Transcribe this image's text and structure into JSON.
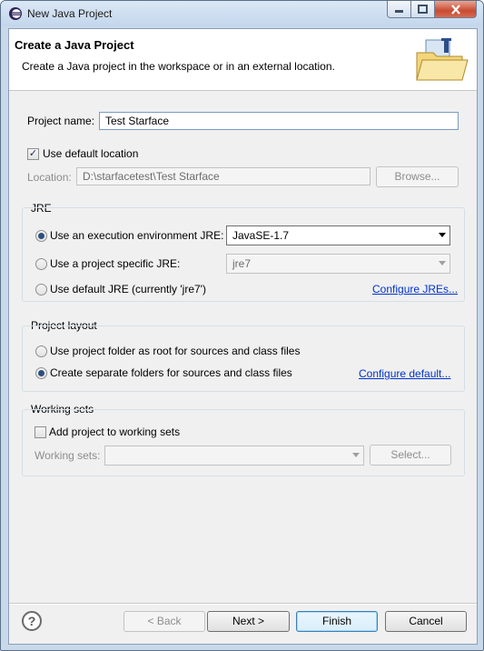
{
  "window": {
    "title": "New Java Project",
    "controls": {
      "minimize": "minimize-icon",
      "maximize": "maximize-icon",
      "close": "close-icon"
    }
  },
  "header": {
    "title": "Create a Java Project",
    "description": "Create a Java project in the workspace or in an external location.",
    "icon": "new-java-project-wizard-icon"
  },
  "project": {
    "name_label": "Project name:",
    "name_value": "Test Starface",
    "use_default_location_label": "Use default location",
    "use_default_location_checked": true,
    "location_label": "Location:",
    "location_value": "D:\\starfacetest\\Test Starface",
    "browse_label": "Browse..."
  },
  "jre": {
    "group_label": "JRE",
    "options": [
      {
        "label": "Use an execution environment JRE:",
        "selected": true
      },
      {
        "label": "Use a project specific JRE:",
        "selected": false
      },
      {
        "label": "Use default JRE (currently 'jre7')",
        "selected": false
      }
    ],
    "execution_env_value": "JavaSE-1.7",
    "project_jre_value": "jre7",
    "configure_link": "Configure JREs..."
  },
  "layout": {
    "group_label": "Project layout",
    "options": [
      {
        "label": "Use project folder as root for sources and class files",
        "selected": false
      },
      {
        "label": "Create separate folders for sources and class files",
        "selected": true
      }
    ],
    "configure_link": "Configure default..."
  },
  "working_sets": {
    "group_label": "Working sets",
    "add_label": "Add project to working sets",
    "add_checked": false,
    "sets_label": "Working sets:",
    "sets_value": "",
    "select_label": "Select..."
  },
  "footer": {
    "back_label": "< Back",
    "next_label": "Next >",
    "finish_label": "Finish",
    "cancel_label": "Cancel",
    "help_icon": "help-icon"
  }
}
